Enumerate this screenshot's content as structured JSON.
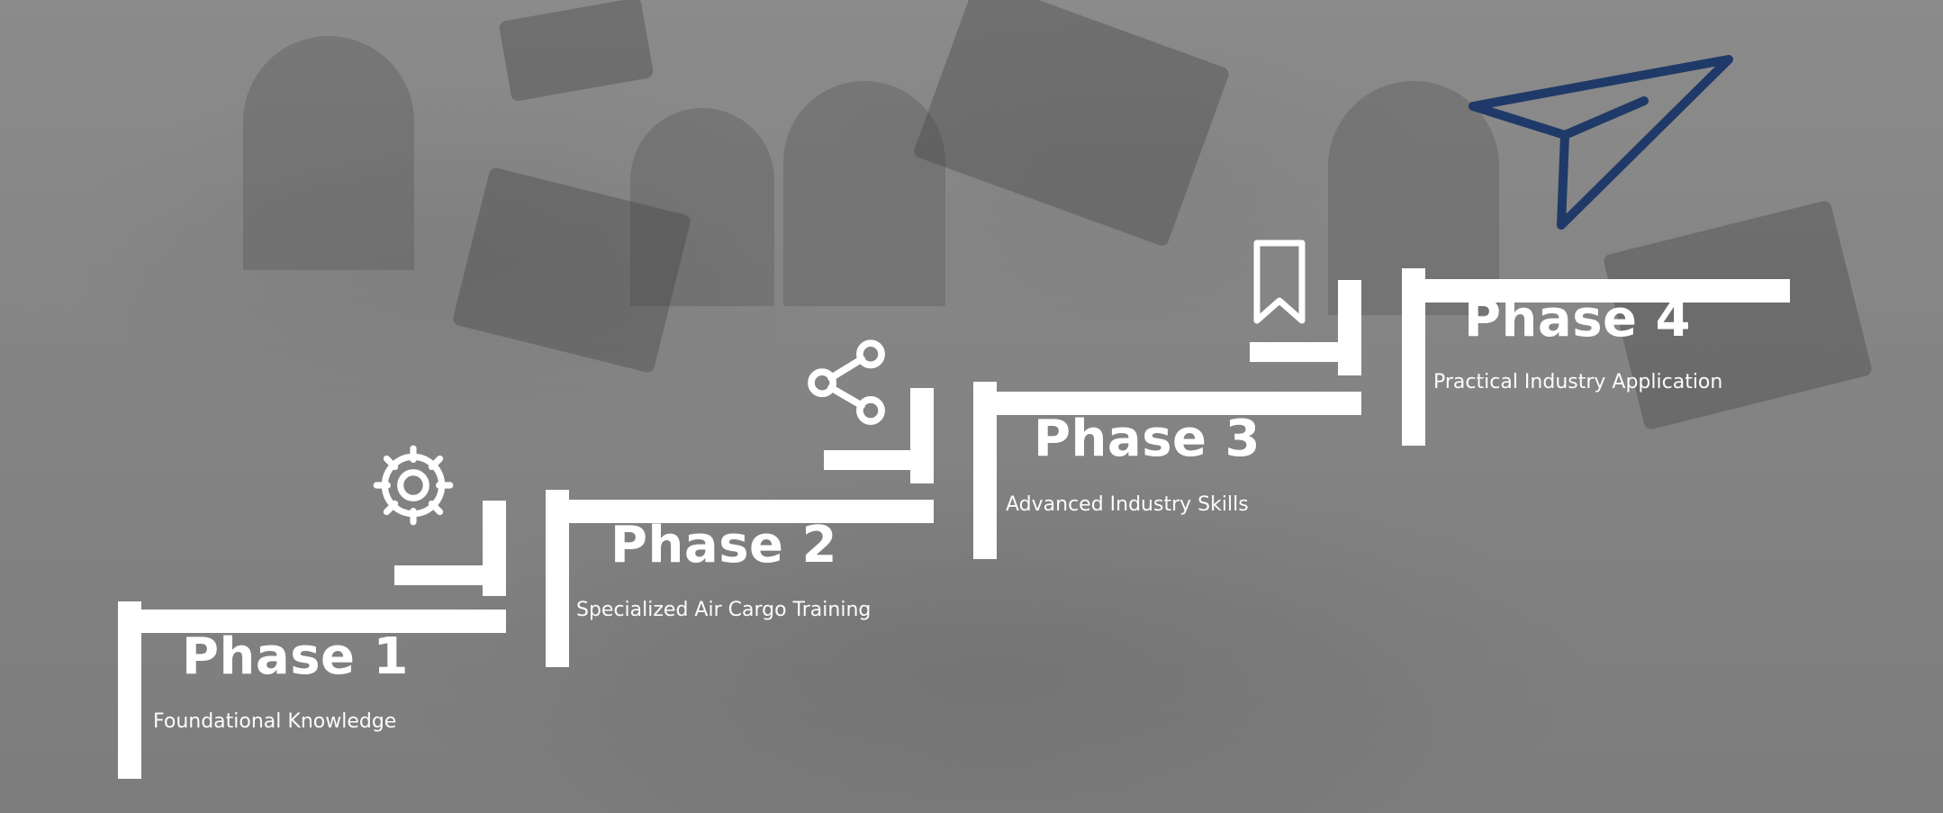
{
  "phases": [
    {
      "title": "Phase 1",
      "subtitle": "Foundational Knowledge",
      "icon": "gear-icon"
    },
    {
      "title": "Phase 2",
      "subtitle": "Specialized Air Cargo Training",
      "icon": "share-icon"
    },
    {
      "title": "Phase 3",
      "subtitle": "Advanced Industry Skills",
      "icon": "bookmark-icon"
    },
    {
      "title": "Phase 4",
      "subtitle": "Practical Industry Application",
      "icon": "paper-plane-icon"
    }
  ],
  "colors": {
    "overlay_white": "#ffffff",
    "plane_blue": "#1f3a68"
  }
}
